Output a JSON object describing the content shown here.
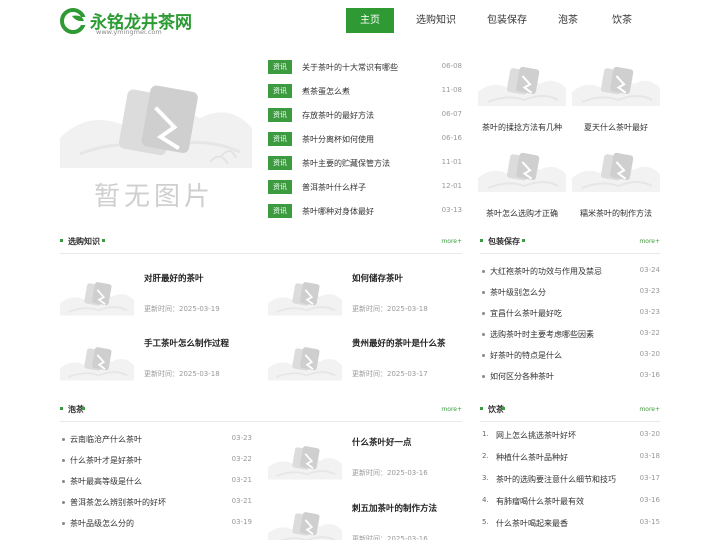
{
  "header": {
    "logo_title": "永铭龙井茶网",
    "logo_url": "www.ymingmei.com",
    "nav": [
      {
        "label": "主页",
        "active": true
      },
      {
        "label": "选购知识",
        "active": false
      },
      {
        "label": "包装保存",
        "active": false
      },
      {
        "label": "泡茶",
        "active": false
      },
      {
        "label": "饮茶",
        "active": false
      }
    ]
  },
  "hero": {
    "caption": "暂无图片"
  },
  "news": {
    "tag": "资讯",
    "items": [
      {
        "title": "关于茶叶的十大常识有哪些",
        "date": "06-08"
      },
      {
        "title": "煮茶蛋怎么煮",
        "date": "11-08"
      },
      {
        "title": "存放茶叶的最好方法",
        "date": "06-07"
      },
      {
        "title": "茶叶分离杯如何使用",
        "date": "06-16"
      },
      {
        "title": "茶叶主要的贮藏保管方法",
        "date": "11-01"
      },
      {
        "title": "普洱茶叶什么样子",
        "date": "12-01"
      },
      {
        "title": "茶叶哪种对身体最好",
        "date": "03-13"
      }
    ]
  },
  "thumbs": [
    {
      "caption": "茶叶的揉捻方法有几种"
    },
    {
      "caption": "夏天什么茶叶最好"
    },
    {
      "caption": "茶叶怎么选购才正确"
    },
    {
      "caption": "糯米茶叶的制作方法"
    }
  ],
  "time_label": "更新时间：",
  "more_label": "more+",
  "sections": {
    "xuangou": {
      "title": "选购知识",
      "cards": [
        {
          "title": "对肝最好的茶叶",
          "time": "2025-03-19"
        },
        {
          "title": "如何储存茶叶",
          "time": "2025-03-18"
        },
        {
          "title": "手工茶叶怎么制作过程",
          "time": "2025-03-18"
        },
        {
          "title": "贵州最好的茶叶是什么茶",
          "time": "2025-03-17"
        }
      ]
    },
    "baozhuang": {
      "title": "包装保存",
      "items": [
        {
          "title": "大红袍茶叶的功效与作用及禁忌",
          "date": "03-24"
        },
        {
          "title": "茶叶级别怎么分",
          "date": "03-23"
        },
        {
          "title": "宜昌什么茶叶最好吃",
          "date": "03-23"
        },
        {
          "title": "选购茶叶时主要考虑哪些因素",
          "date": "03-22"
        },
        {
          "title": "好茶叶的特点是什么",
          "date": "03-20"
        },
        {
          "title": "如何区分各种茶叶",
          "date": "03-16"
        }
      ]
    },
    "paocha": {
      "title": "泡茶",
      "items": [
        {
          "title": "云南临沧产什么茶叶",
          "date": "03-23"
        },
        {
          "title": "什么茶叶才是好茶叶",
          "date": "03-22"
        },
        {
          "title": "茶叶最高等级是什么",
          "date": "03-21"
        },
        {
          "title": "普洱茶怎么辨别茶叶的好坏",
          "date": "03-21"
        },
        {
          "title": "茶叶品级怎么分的",
          "date": "03-19"
        }
      ],
      "cards": [
        {
          "title": "什么茶叶好一点",
          "time": "2025-03-16"
        },
        {
          "title": "刺五加茶叶的制作方法",
          "time": "2025-03-16"
        }
      ]
    },
    "yincha": {
      "title": "饮茶",
      "items": [
        {
          "num": "1.",
          "title": "网上怎么挑选茶叶好坏",
          "date": "03-20"
        },
        {
          "num": "2.",
          "title": "种植什么茶叶品种好",
          "date": "03-18"
        },
        {
          "num": "3.",
          "title": "茶叶的选购要注意什么细节和技巧",
          "date": "03-17"
        },
        {
          "num": "4.",
          "title": "有肺瘤喝什么茶叶最有效",
          "date": "03-16"
        },
        {
          "num": "5.",
          "title": "什么茶叶喝起来最香",
          "date": "03-15"
        }
      ]
    }
  },
  "colors": {
    "brand": "#2f9a34",
    "tag": "#3c9a3f"
  }
}
